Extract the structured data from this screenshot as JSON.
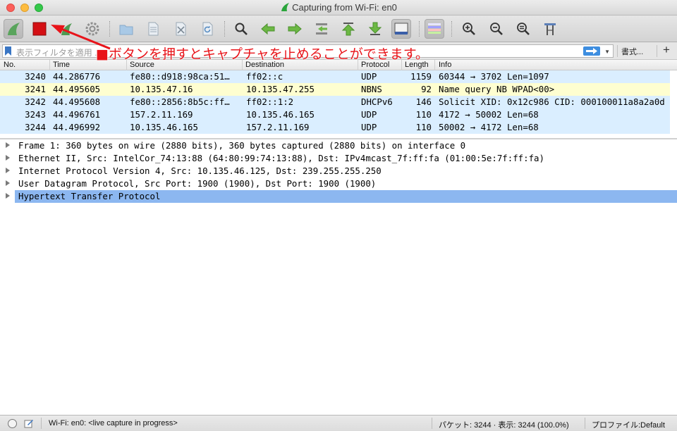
{
  "window": {
    "title": "Capturing from Wi-Fi: en0"
  },
  "toolbar": {
    "buttons": [
      "start-capture",
      "stop-capture",
      "restart-capture",
      "capture-options",
      "open-file",
      "save-file",
      "close-file",
      "reload-file",
      "find-packet",
      "go-back",
      "go-forward",
      "go-to-packet",
      "go-first",
      "go-last",
      "autoscroll",
      "colorize",
      "zoom-in",
      "zoom-out",
      "zoom-normal",
      "resize-columns"
    ]
  },
  "filter": {
    "placeholder": "表示フィルタを適用 ...",
    "expression_label": "書式...",
    "add_label": "+"
  },
  "annotation": {
    "text": "■ボタンを押すとキャプチャを止めることができます。",
    "color": "#e8141a"
  },
  "packet_list": {
    "columns": [
      "No.",
      "Time",
      "Source",
      "Destination",
      "Protocol",
      "Length",
      "Info"
    ],
    "rows": [
      {
        "no": "3240",
        "time": "44.286776",
        "source": "fe80::d918:98ca:51…",
        "destination": "ff02::c",
        "protocol": "UDP",
        "length": "1159",
        "info": "60344 → 3702  Len=1097",
        "color": "#daeeff"
      },
      {
        "no": "3241",
        "time": "44.495605",
        "source": "10.135.47.16",
        "destination": "10.135.47.255",
        "protocol": "NBNS",
        "length": "92",
        "info": "Name query NB WPAD<00>",
        "color": "#fefed0"
      },
      {
        "no": "3242",
        "time": "44.495608",
        "source": "fe80::2856:8b5c:ff…",
        "destination": "ff02::1:2",
        "protocol": "DHCPv6",
        "length": "146",
        "info": "Solicit XID: 0x12c986 CID: 000100011a8a2a0d",
        "color": "#daeeff"
      },
      {
        "no": "3243",
        "time": "44.496761",
        "source": "157.2.11.169",
        "destination": "10.135.46.165",
        "protocol": "UDP",
        "length": "110",
        "info": "4172 → 50002  Len=68",
        "color": "#daeeff"
      },
      {
        "no": "3244",
        "time": "44.496992",
        "source": "10.135.46.165",
        "destination": "157.2.11.169",
        "protocol": "UDP",
        "length": "110",
        "info": "50002 → 4172  Len=68",
        "color": "#daeeff"
      }
    ]
  },
  "details": {
    "rows": [
      {
        "text": "Frame 1: 360 bytes on wire (2880 bits), 360 bytes captured (2880 bits) on interface 0",
        "selected": false
      },
      {
        "text": "Ethernet II, Src: IntelCor_74:13:88 (64:80:99:74:13:88), Dst: IPv4mcast_7f:ff:fa (01:00:5e:7f:ff:fa)",
        "selected": false
      },
      {
        "text": "Internet Protocol Version 4, Src: 10.135.46.125, Dst: 239.255.255.250",
        "selected": false
      },
      {
        "text": "User Datagram Protocol, Src Port: 1900 (1900), Dst Port: 1900 (1900)",
        "selected": false
      },
      {
        "text": "Hypertext Transfer Protocol",
        "selected": true
      }
    ]
  },
  "status": {
    "interface": "Wi-Fi: en0: <live capture in progress>",
    "packets": "パケット: 3244 · 表示: 3244 (100.0%)",
    "profile": "プロファイル:Default"
  },
  "colors": {
    "selection": "#8cb7f0",
    "udp_row": "#daeeff",
    "nbns_row": "#fefed0",
    "stop_button": "#d40f14"
  }
}
